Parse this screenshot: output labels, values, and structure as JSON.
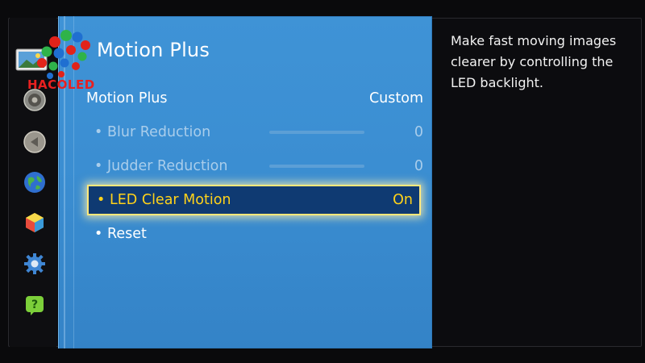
{
  "logo": {
    "text": "HACOLED"
  },
  "sidebar": {
    "items": [
      {
        "icon": "picture-icon"
      },
      {
        "icon": "speaker-icon"
      },
      {
        "icon": "broadcast-icon"
      },
      {
        "icon": "globe-icon"
      },
      {
        "icon": "smart-hub-cube-icon"
      },
      {
        "icon": "gear-icon"
      },
      {
        "icon": "help-icon"
      }
    ]
  },
  "menu": {
    "title": "Motion Plus",
    "rows": [
      {
        "label": "Motion Plus",
        "value": "Custom"
      },
      {
        "label": "Blur Reduction",
        "value": "0",
        "level": 0
      },
      {
        "label": "Judder Reduction",
        "value": "0",
        "level": 0
      },
      {
        "label": "LED Clear Motion",
        "value": "On"
      },
      {
        "label": "Reset",
        "value": ""
      }
    ],
    "bullet": "•"
  },
  "info": {
    "text": "Make fast moving images clearer by controlling the LED backlight."
  },
  "colors": {
    "panel_blue": "#3b8ed2",
    "selected_bg": "#0f3a72",
    "selected_text": "#ffd21a",
    "dim_text": "#a9cdeb",
    "logo_red": "#e82020"
  }
}
